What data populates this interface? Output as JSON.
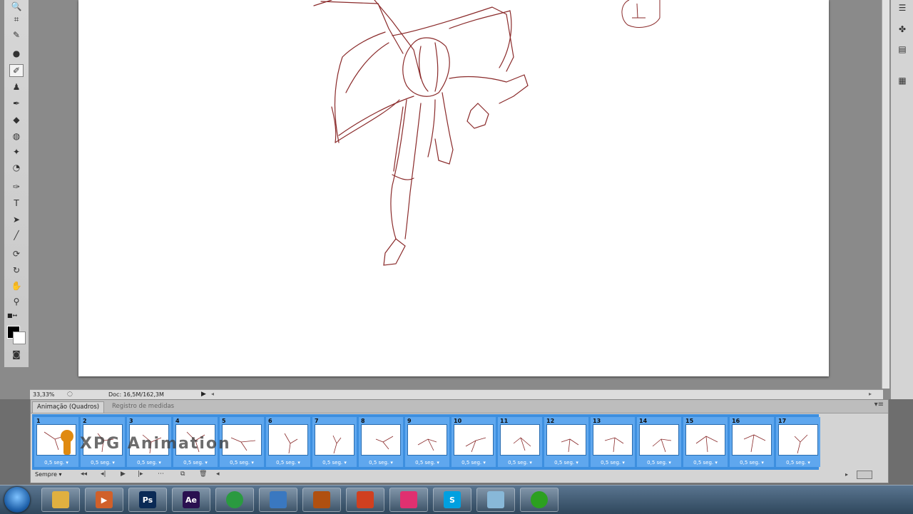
{
  "status_bar": {
    "zoom": "33,33%",
    "doc_info": "Doc: 16,5M/162,3M"
  },
  "animation_panel": {
    "tabs": [
      {
        "label": "Animação (Quadros)"
      },
      {
        "label": "Registro de medidas"
      }
    ],
    "loop_option": "Sempre",
    "frames": [
      {
        "number": "1",
        "delay": "0,5 seg."
      },
      {
        "number": "2",
        "delay": "0,5 seg."
      },
      {
        "number": "3",
        "delay": "0,5 seg."
      },
      {
        "number": "4",
        "delay": "0,5 seg."
      },
      {
        "number": "5",
        "delay": "0,5 seg."
      },
      {
        "number": "6",
        "delay": "0,5 seg."
      },
      {
        "number": "7",
        "delay": "0,5 seg."
      },
      {
        "number": "8",
        "delay": "0,5 seg."
      },
      {
        "number": "9",
        "delay": "0,5 seg."
      },
      {
        "number": "10",
        "delay": "0,5 seg."
      },
      {
        "number": "11",
        "delay": "0,5 seg."
      },
      {
        "number": "12",
        "delay": "0,5 seg."
      },
      {
        "number": "13",
        "delay": "0,5 seg."
      },
      {
        "number": "14",
        "delay": "0,5 seg."
      },
      {
        "number": "15",
        "delay": "0,5 seg."
      },
      {
        "number": "16",
        "delay": "0,5 seg."
      },
      {
        "number": "17",
        "delay": "0,5 seg."
      }
    ]
  },
  "watermark": {
    "text": "XPG Animation"
  },
  "tools": [
    "zoom-tool-icon",
    "crop-tool-icon",
    "eyedropper-tool-icon",
    "spot-healing-tool-icon",
    "brush-tool-icon",
    "clone-stamp-tool-icon",
    "history-brush-tool-icon",
    "eraser-tool-icon",
    "paint-bucket-tool-icon",
    "blur-tool-icon",
    "dodge-tool-icon",
    "pen-tool-icon",
    "type-tool-icon",
    "path-selection-tool-icon",
    "line-tool-icon",
    "3d-rotate-tool-icon",
    "3d-orbit-tool-icon",
    "hand-tool-icon",
    "zoom-view-tool-icon"
  ],
  "taskbar_apps": [
    "windows-explorer-icon",
    "media-player-icon",
    "photoshop-icon",
    "after-effects-icon",
    "chrome-icon",
    "messenger-icon",
    "baseball-glove-icon",
    "media-center-icon",
    "app-icon",
    "skype-icon",
    "notepad-icon",
    "green-app-icon"
  ],
  "colors": {
    "brush_stroke": "#8a2a2a",
    "frame_selected": "#3d8fdf",
    "canvas": "#ffffff"
  }
}
